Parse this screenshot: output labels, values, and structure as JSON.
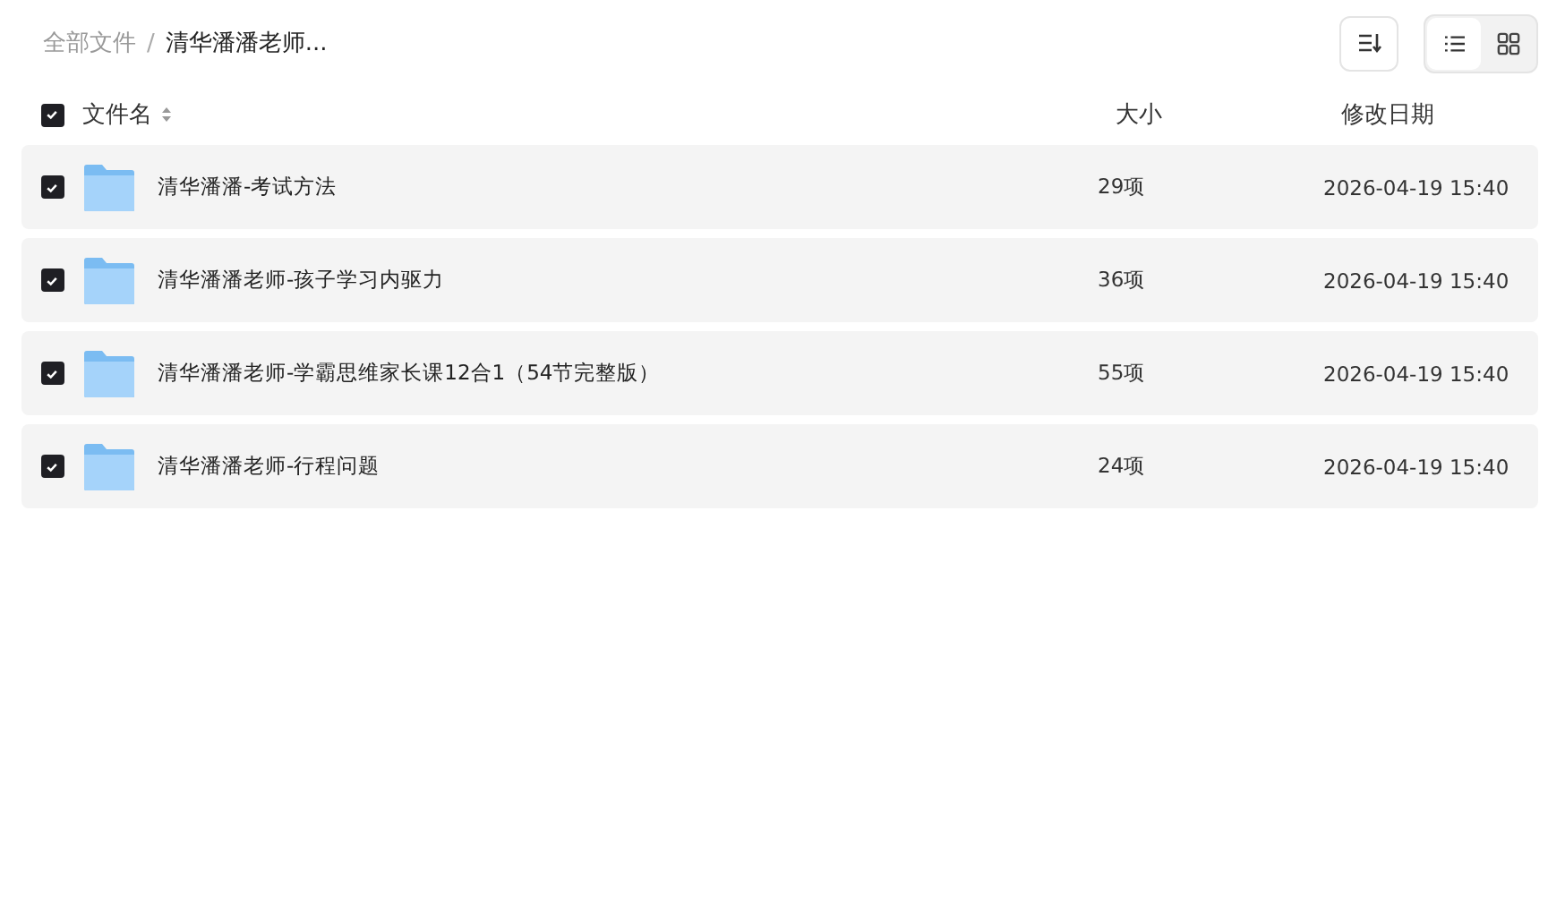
{
  "breadcrumb": [
    {
      "label": "全部文件",
      "current": false
    },
    {
      "label": "清华潘潘老师...",
      "current": true
    }
  ],
  "breadcrumb_separator": "/",
  "view_toggle": [
    {
      "kind": "list",
      "selected": true
    },
    {
      "kind": "grid",
      "selected": false
    }
  ],
  "header": {
    "checked": true,
    "columns": [
      "文件名",
      "大小",
      "修改日期"
    ]
  },
  "rows": [
    {
      "name": "清华潘潘-考试方法",
      "size": "29项",
      "date": "2026-04-19 15:40",
      "checked": true
    },
    {
      "name": "清华潘潘老师-孩子学习内驱力",
      "size": "36项",
      "date": "2026-04-19 15:40",
      "checked": true
    },
    {
      "name": "清华潘潘老师-学霸思维家长课12合1（54节完整版）",
      "size": "55项",
      "date": "2026-04-19 15:40",
      "checked": true
    },
    {
      "name": "清华潘潘老师-行程问题",
      "size": "24项",
      "date": "2026-04-19 15:40",
      "checked": true
    }
  ]
}
